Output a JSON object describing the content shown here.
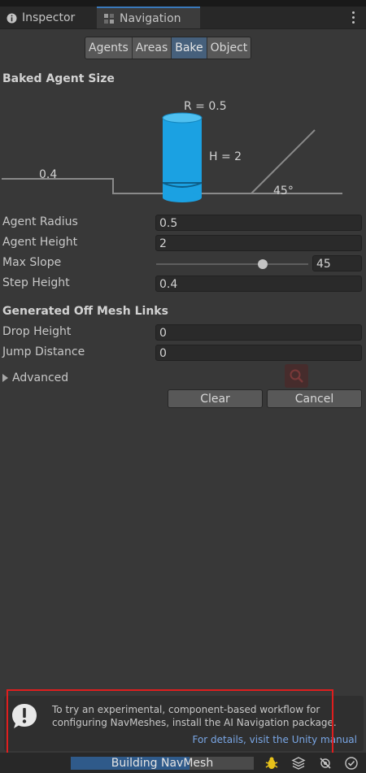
{
  "tabs": [
    {
      "label": "Inspector",
      "icon": "info-icon"
    },
    {
      "label": "Navigation",
      "icon": "navigation-icon"
    }
  ],
  "segments": [
    "Agents",
    "Areas",
    "Bake",
    "Object"
  ],
  "active_segment": "Bake",
  "baked_agent_size": {
    "title": "Baked Agent Size",
    "diagram": {
      "radius_label": "R = 0.5",
      "height_label": "H = 2",
      "step_label": "0.4",
      "slope_label": "45°"
    }
  },
  "agent_props": [
    {
      "label": "Agent Radius",
      "value": "0.5"
    },
    {
      "label": "Agent Height",
      "value": "2"
    },
    {
      "label": "Max Slope",
      "value": "45",
      "slider_fraction": 0.7
    },
    {
      "label": "Step Height",
      "value": "0.4"
    }
  ],
  "off_mesh": {
    "title": "Generated Off Mesh Links",
    "props": [
      {
        "label": "Drop Height",
        "value": "0"
      },
      {
        "label": "Jump Distance",
        "value": "0"
      }
    ]
  },
  "advanced_label": "Advanced",
  "buttons": {
    "clear": "Clear",
    "cancel": "Cancel"
  },
  "notice": {
    "text": "To try an experimental, component-based workflow for configuring NavMeshes, install the AI Navigation package.",
    "link": "For details, visit the Unity manual"
  },
  "status": {
    "progress_label": "Building NavMesh",
    "progress_fraction": 0.65
  },
  "colors": {
    "accent": "#3a79bb",
    "cylinder": "#1ba1e2",
    "link": "#7aa7e6",
    "highlight": "#e01e1e"
  }
}
